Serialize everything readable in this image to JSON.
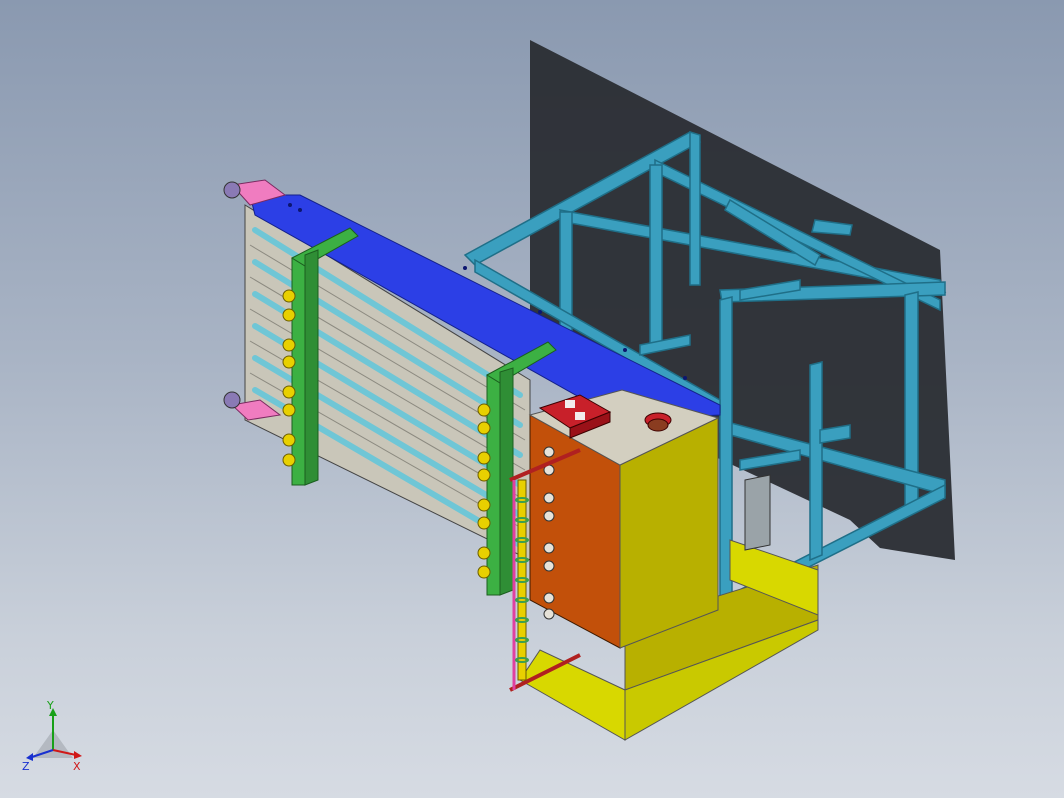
{
  "viewport": {
    "background_top": "#8a99b0",
    "background_bottom": "#d6dbe3"
  },
  "colors": {
    "frame": "#3a9fbf",
    "frame_edge": "#1f6f88",
    "blue_plate": "#2c3fe6",
    "green_bracket": "#3cb043",
    "orange_box": "#c2500a",
    "yellow_box": "#b8b000",
    "yellow_base": "#d8d800",
    "slats": "#c9c6b9",
    "rods": "#6fc6d6",
    "pink_part": "#f07cc0",
    "red_part": "#c8202a",
    "knob_yellow": "#e8d000",
    "shadow": "#2a2d33"
  },
  "triad": {
    "x_label": "X",
    "y_label": "Y",
    "z_label": "Z"
  }
}
